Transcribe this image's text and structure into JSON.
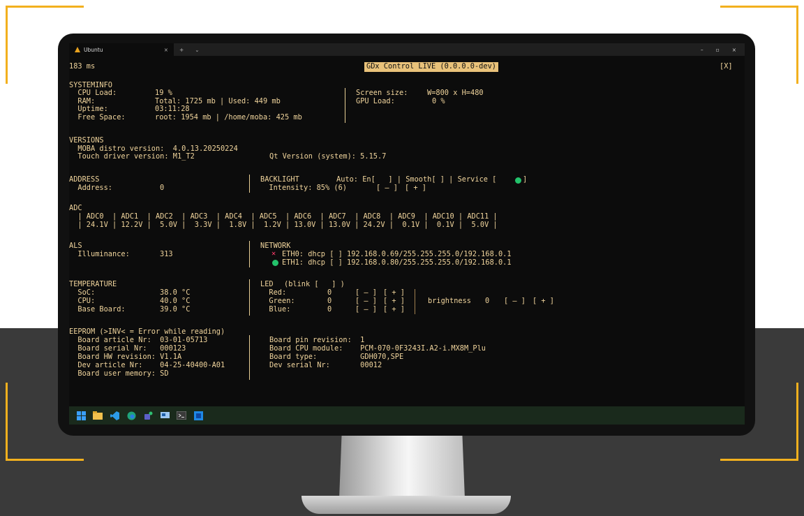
{
  "window": {
    "tab_title": "Ubuntu",
    "tab_close": "×",
    "new_tab": "+",
    "tab_menu": "⌄",
    "controls": {
      "minimize": "–",
      "maximize": "▫",
      "close": "×"
    }
  },
  "header": {
    "latency": "183 ms",
    "title": "GDx Control LIVE (0.0.0.0-dev)",
    "close": "[X]"
  },
  "systeminfo": {
    "heading": "SYSTEMINFO",
    "cpu_label": "  CPU Load:",
    "cpu_value": "19 %",
    "ram_label": "  RAM:",
    "ram_value": "Total: 1725 mb | Used: 449 mb",
    "uptime_label": "  Uptime:",
    "uptime_value": "03:11:28",
    "free_label": "  Free Space:",
    "free_value": "root: 1954 mb | /home/moba: 425 mb",
    "screen_label": "Screen size:",
    "screen_value": "W=800 x H=480",
    "gpu_label": "GPU Load:",
    "gpu_value": "0 %"
  },
  "versions": {
    "heading": "VERSIONS",
    "moba": "  MOBA distro version:  4.0.13.20250224",
    "touch": "  Touch driver version: M1_T2",
    "qt": "Qt Version (system): 5.15.7"
  },
  "address": {
    "heading": "ADDRESS",
    "label": "  Address:",
    "value": "0"
  },
  "backlight": {
    "heading": "BACKLIGHT",
    "auto": "Auto: En[   ] | Smooth[ ] | Service [",
    "service_close": "]",
    "intensity": "  Intensity: 85% (6)",
    "minus": "[ – ]",
    "plus": "[ + ]"
  },
  "adc": {
    "heading": "ADC",
    "header_row": "  | ADC0  | ADC1  | ADC2  | ADC3  | ADC4  | ADC5  | ADC6  | ADC7  | ADC8  | ADC9  | ADC10 | ADC11 |",
    "value_row": "  | 24.1V | 12.2V |  5.0V |  3.3V |  1.8V |  1.2V | 13.0V | 13.0V | 24.2V |  0.1V |  0.1V |  5.0V |"
  },
  "als": {
    "heading": "ALS",
    "label": "  Illuminance:",
    "value": "313"
  },
  "network": {
    "heading": "NETWORK",
    "eth0": "ETH0: dhcp [ ] 192.168.0.69/255.255.255.0/192.168.0.1",
    "eth1": "ETH1: dhcp [ ] 192.168.0.80/255.255.255.0/192.168.0.1",
    "eth0_status_icon": "x-mark-icon",
    "eth1_status_icon": "green-dot-icon"
  },
  "temperature": {
    "heading": "TEMPERATURE",
    "soc_label": "  SoC:",
    "soc_value": "38.0 °C",
    "cpu_label": "  CPU:",
    "cpu_value": "40.0 °C",
    "board_label": "  Base Board:",
    "board_value": "39.0 °C"
  },
  "led": {
    "heading": "LED",
    "blink": "(blink [   ] )",
    "red_label": "  Red:",
    "red_value": "0",
    "green_label": "  Green:",
    "green_value": "0",
    "blue_label": "  Blue:",
    "blue_value": "0",
    "minus": "[ – ]",
    "plus": "[ + ]",
    "brightness_label": "brightness",
    "brightness_value": "0"
  },
  "eeprom": {
    "heading": "EEPROM (>INV< = Error while reading)",
    "article": "  Board article Nr:  03-01-05713",
    "serial": "  Board serial Nr:   000123",
    "hw": "  Board HW revision: V1.1A",
    "dev_article": "  Dev article Nr:    04-25-40400-A01",
    "user_mem": "  Board user memory: SD",
    "pin_rev": "Board pin revision:  1",
    "cpu_module": "Board CPU module:    PCM-070-0F3243I.A2-i.MX8M_Plu",
    "board_type": "Board type:          GDH070,SPE",
    "dev_serial": "Dev serial Nr:       00012"
  },
  "colors": {
    "text": "#f0d49c",
    "accent": "#e9c27a",
    "ok": "#23c26b",
    "error": "#ff3b6b",
    "frame": "#f2b01e"
  }
}
